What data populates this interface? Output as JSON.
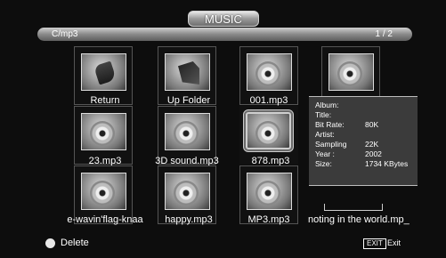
{
  "header": {
    "title": "MUSIC"
  },
  "path_bar": {
    "path": "C/mp3",
    "page": "1 / 2"
  },
  "items": [
    {
      "label": "Return",
      "icon": "return-icon"
    },
    {
      "label": "Up Folder",
      "icon": "up-folder-icon"
    },
    {
      "label": "001.mp3",
      "icon": "music-disc-icon"
    },
    {
      "label": "",
      "icon": "music-disc-icon"
    },
    {
      "label": "23.mp3",
      "icon": "music-disc-icon"
    },
    {
      "label": "3D sound.mp3",
      "icon": "music-disc-icon"
    },
    {
      "label": "878.mp3",
      "icon": "music-disc-icon"
    },
    {
      "label": "e-wavin'flag-knaa",
      "icon": "music-disc-icon"
    },
    {
      "label": "happy.mp3",
      "icon": "music-disc-icon"
    },
    {
      "label": "MP3.mp3",
      "icon": "music-disc-icon"
    },
    {
      "label": "noting in the world.mp_",
      "icon": "music-disc-icon"
    }
  ],
  "info": {
    "album_label": "Album:",
    "album": "",
    "title_label": "Title:",
    "title": "",
    "bitrate_label": "Bit Rate:",
    "bitrate": "80K",
    "artist_label": "Artist:",
    "artist": "",
    "sampling_label": "Sampling",
    "sampling": "22K",
    "year_label": "Year :",
    "year": "2002",
    "size_label": "Size:",
    "size": "1734 KBytes"
  },
  "footer": {
    "delete_label": "Delete",
    "exit_key": "EXIT",
    "exit_label": "Exit"
  },
  "colors": {
    "background": "#0d0d0d",
    "panel": "#3b3b3b",
    "accent": "#bdbdbd"
  }
}
